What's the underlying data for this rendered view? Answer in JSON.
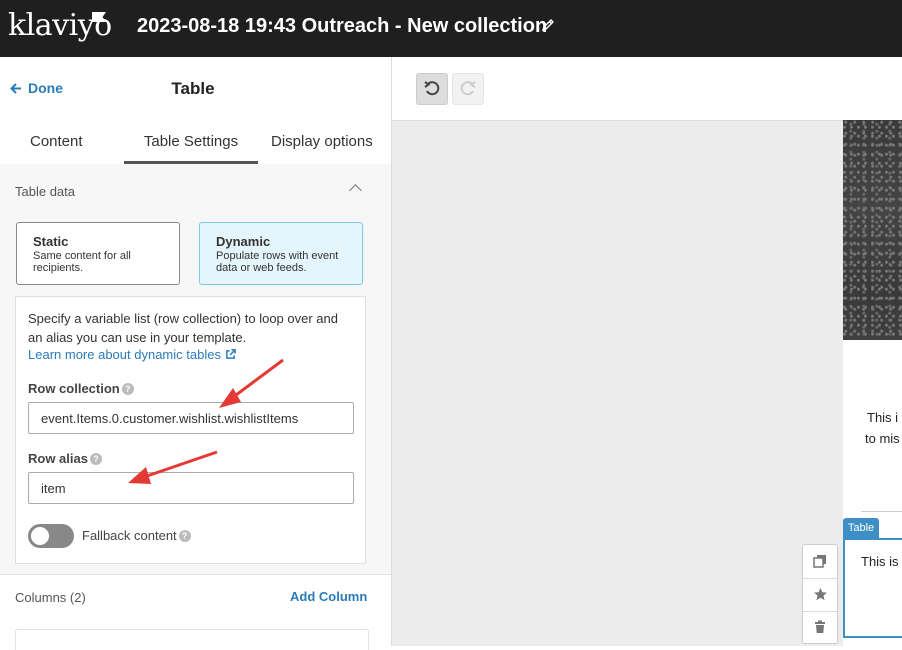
{
  "app": {
    "logo": "klaviyo",
    "title": "2023-08-18 19:43 Outreach - New collection"
  },
  "panel": {
    "done_label": "Done",
    "title": "Table",
    "tabs": [
      {
        "label": "Content"
      },
      {
        "label": "Table Settings",
        "active": true
      },
      {
        "label": "Display options"
      }
    ],
    "table_data": {
      "heading": "Table data",
      "options": [
        {
          "title": "Static",
          "description": "Same content for all recipients."
        },
        {
          "title": "Dynamic",
          "description": "Populate rows with event data or web feeds.",
          "selected": true
        }
      ],
      "description": "Specify a variable list (row collection) to loop over and an alias you can use in your template.",
      "learn_more": "Learn more about dynamic tables",
      "row_collection": {
        "label": "Row collection",
        "value": "event.Items.0.customer.wishlist.wishlistItems"
      },
      "row_alias": {
        "label": "Row alias",
        "value": "item"
      },
      "fallback": {
        "label": "Fallback content",
        "enabled": false
      }
    },
    "columns": {
      "label": "Columns (2)",
      "add_label": "Add Column"
    }
  },
  "editor": {
    "canvas_text_1": "This i",
    "canvas_text_2": "to mis",
    "table_tag": "Table",
    "table_text": "This is",
    "actions": [
      "duplicate-icon",
      "star-icon",
      "trash-icon"
    ]
  },
  "colors": {
    "topbar": "#1f1f1f",
    "link": "#2b7bb9",
    "selected_option_bg": "#e4f5fc",
    "selected_block": "#3d8fc6",
    "annotation_arrow": "#e53935"
  }
}
